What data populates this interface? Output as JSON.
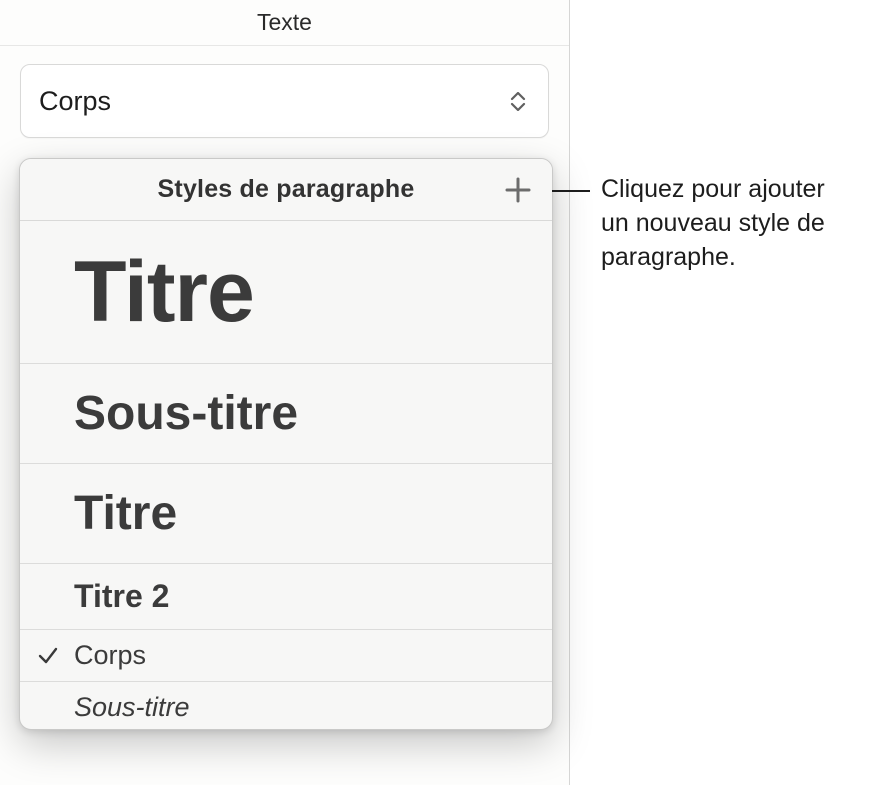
{
  "panel": {
    "title": "Texte"
  },
  "selector": {
    "current_style": "Corps"
  },
  "popover": {
    "title": "Styles de paragraphe",
    "styles": [
      {
        "label": "Titre",
        "selected": false
      },
      {
        "label": "Sous-titre",
        "selected": false
      },
      {
        "label": "Titre",
        "selected": false
      },
      {
        "label": "Titre 2",
        "selected": false
      },
      {
        "label": "Corps",
        "selected": true
      },
      {
        "label": "Sous-titre",
        "selected": false
      }
    ]
  },
  "callout": {
    "line1": "Cliquez pour ajouter",
    "line2": "un nouveau style de",
    "line3": "paragraphe."
  }
}
